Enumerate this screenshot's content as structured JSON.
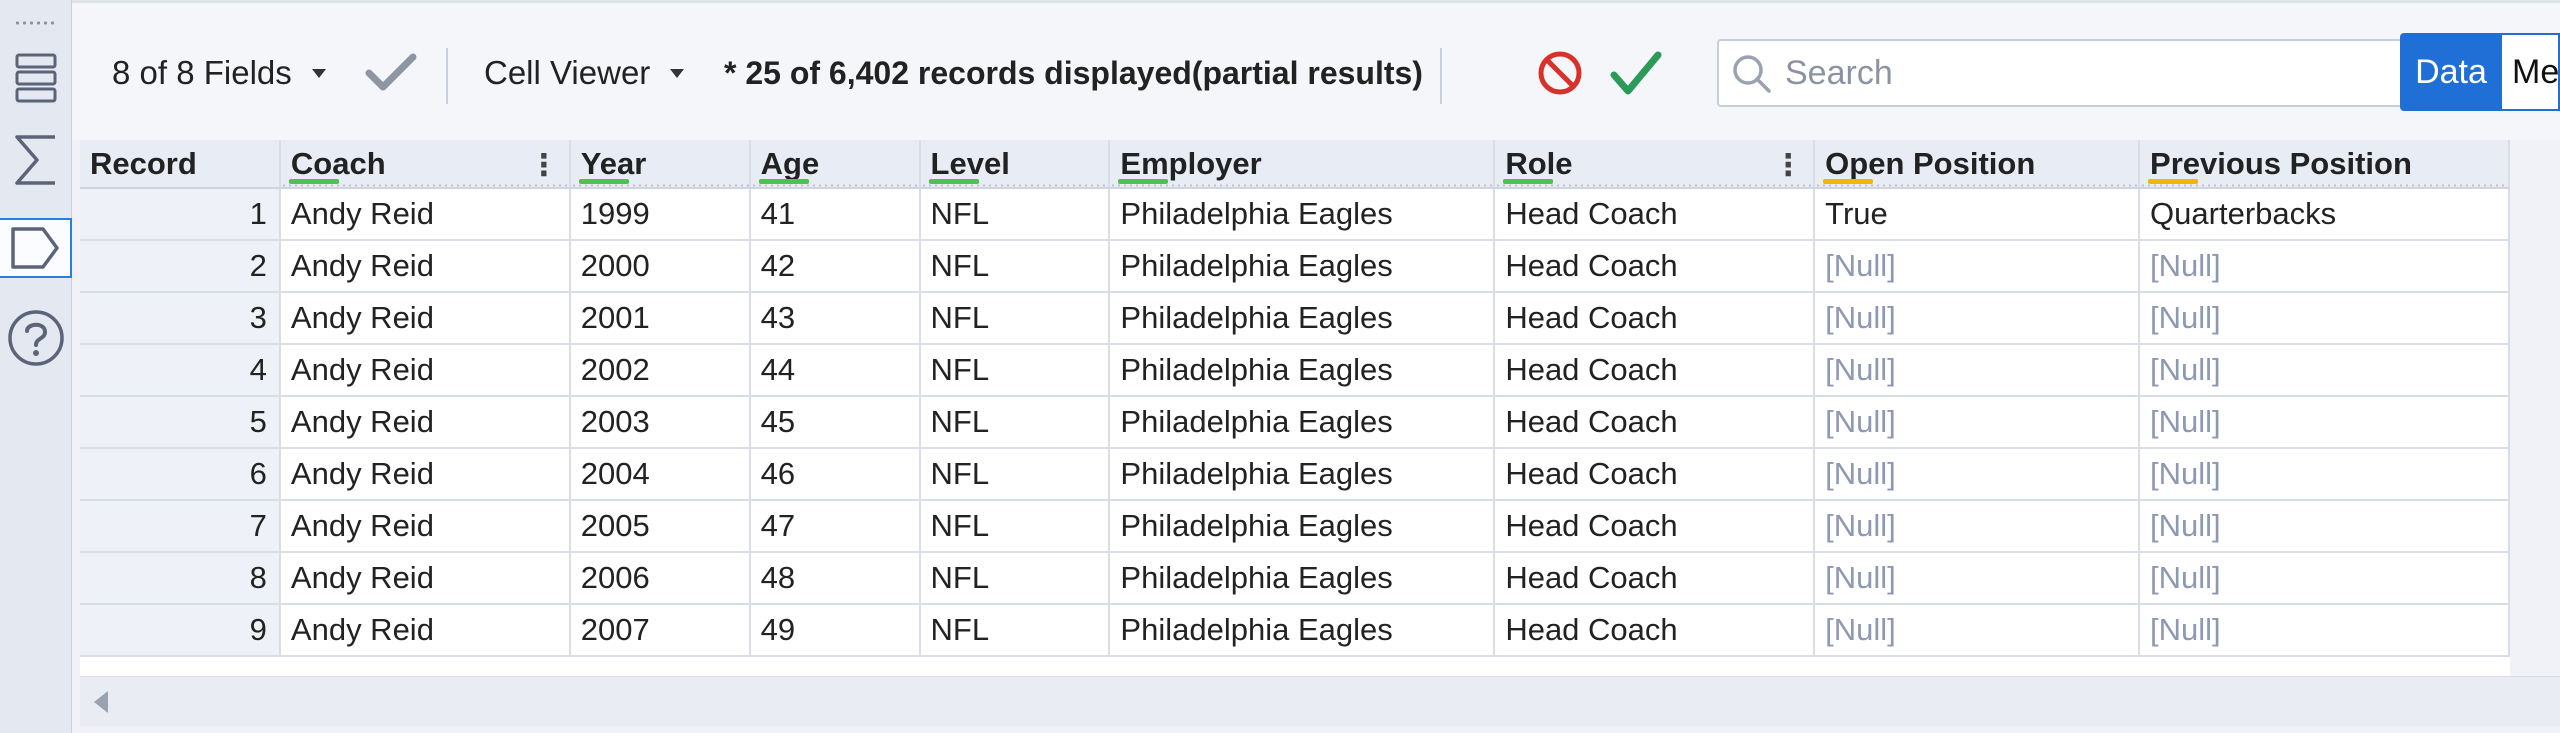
{
  "toolbar": {
    "fields_label": "8 of 8 Fields",
    "viewer_label": "Cell Viewer",
    "status": "* 25 of 6,402 records displayed(partial results)",
    "search_placeholder": "Search",
    "tab_data": "Data",
    "tab_meta": "Me"
  },
  "rail": {
    "icons": [
      "table-rows-icon",
      "sigma-icon",
      "tag-icon",
      "help-icon"
    ]
  },
  "colors": {
    "accent": "#1f6fd6",
    "cancel_red": "#d9302a",
    "apply_green": "#2c9a59",
    "null_text": "#8d98b3",
    "underline_green": "#4cc24f",
    "underline_orange": "#f4b400"
  },
  "grid": {
    "columns": [
      {
        "label": "Record"
      },
      {
        "label": "Coach"
      },
      {
        "label": "Year"
      },
      {
        "label": "Age"
      },
      {
        "label": "Level"
      },
      {
        "label": "Employer"
      },
      {
        "label": "Role"
      },
      {
        "label": "Open Position"
      },
      {
        "label": "Previous Position"
      }
    ],
    "rows": [
      [
        "1",
        "Andy Reid",
        "1999",
        "41",
        "NFL",
        "Philadelphia Eagles",
        "Head Coach",
        "True",
        "Quarterbacks"
      ],
      [
        "2",
        "Andy Reid",
        "2000",
        "42",
        "NFL",
        "Philadelphia Eagles",
        "Head Coach",
        "[Null]",
        "[Null]"
      ],
      [
        "3",
        "Andy Reid",
        "2001",
        "43",
        "NFL",
        "Philadelphia Eagles",
        "Head Coach",
        "[Null]",
        "[Null]"
      ],
      [
        "4",
        "Andy Reid",
        "2002",
        "44",
        "NFL",
        "Philadelphia Eagles",
        "Head Coach",
        "[Null]",
        "[Null]"
      ],
      [
        "5",
        "Andy Reid",
        "2003",
        "45",
        "NFL",
        "Philadelphia Eagles",
        "Head Coach",
        "[Null]",
        "[Null]"
      ],
      [
        "6",
        "Andy Reid",
        "2004",
        "46",
        "NFL",
        "Philadelphia Eagles",
        "Head Coach",
        "[Null]",
        "[Null]"
      ],
      [
        "7",
        "Andy Reid",
        "2005",
        "47",
        "NFL",
        "Philadelphia Eagles",
        "Head Coach",
        "[Null]",
        "[Null]"
      ],
      [
        "8",
        "Andy Reid",
        "2006",
        "48",
        "NFL",
        "Philadelphia Eagles",
        "Head Coach",
        "[Null]",
        "[Null]"
      ],
      [
        "9",
        "Andy Reid",
        "2007",
        "49",
        "NFL",
        "Philadelphia Eagles",
        "Head Coach",
        "[Null]",
        "[Null]"
      ]
    ]
  }
}
